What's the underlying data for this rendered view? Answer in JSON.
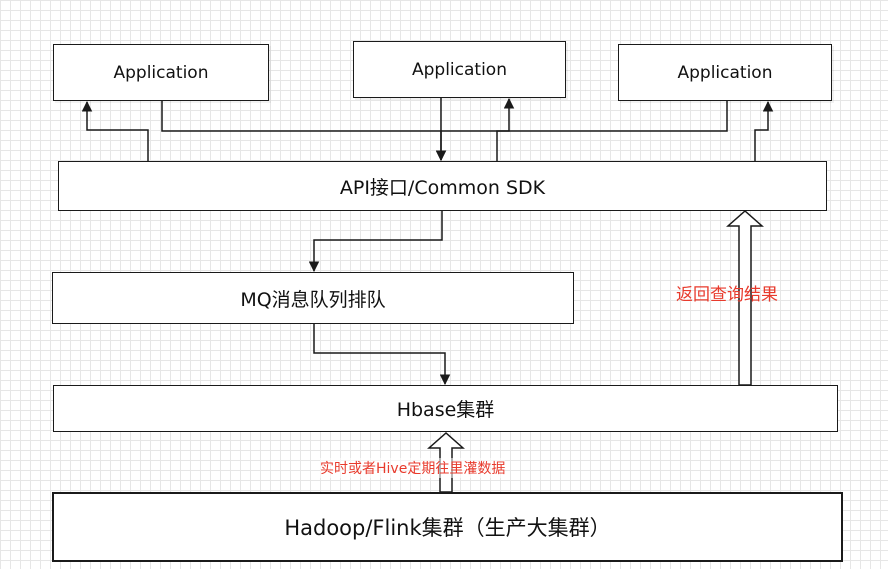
{
  "nodes": {
    "app_left": "Application",
    "app_center": "Application",
    "app_right": "Application",
    "api_sdk": "API接口/Common SDK",
    "mq_queue": "MQ消息队列排队",
    "hbase_cluster": "Hbase集群",
    "hadoop_flink": "Hadoop/Flink集群（生产大集群）"
  },
  "annotations": {
    "return_results": "返回查询结果",
    "feed_data": "实时或者Hive定期往里灌数据"
  },
  "colors": {
    "annotation": "#e83a2c",
    "stroke": "#1a1a1a",
    "grid": "#e6e6e6"
  }
}
